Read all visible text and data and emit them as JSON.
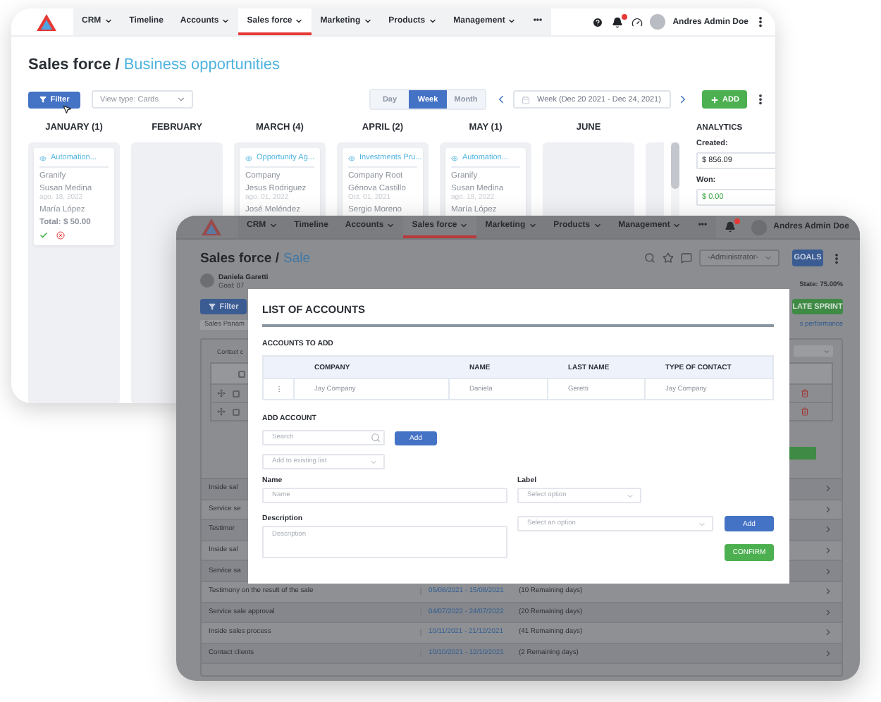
{
  "back_window": {
    "nav": {
      "items": [
        {
          "label": "CRM",
          "dropdown": true,
          "selected": false
        },
        {
          "label": "Timeline",
          "dropdown": false,
          "selected": false
        },
        {
          "label": "Accounts",
          "dropdown": true,
          "selected": false
        },
        {
          "label": "Sales force",
          "dropdown": true,
          "selected": true
        },
        {
          "label": "Marketing",
          "dropdown": true,
          "selected": false
        },
        {
          "label": "Products",
          "dropdown": true,
          "selected": false
        },
        {
          "label": "Management",
          "dropdown": true,
          "selected": false
        },
        {
          "label": "•••",
          "dropdown": false,
          "selected": false
        }
      ],
      "user": "Andres Admin Doe"
    },
    "title": {
      "section": "Sales force /",
      "page": "Business opportunities"
    },
    "toolbar": {
      "filter": "Filter",
      "view_type": "View type: Cards",
      "periods": [
        {
          "label": "Day",
          "selected": false
        },
        {
          "label": "Week",
          "selected": true
        },
        {
          "label": "Month",
          "selected": false
        }
      ],
      "week_range": "Week (Dec 20 2021 - Dec 24, 2021)",
      "add": "ADD"
    },
    "columns": [
      {
        "title": "JANUARY (1)",
        "cards": [
          {
            "link": "Automation...",
            "company": "Granify",
            "contact": "Susan Medina",
            "date": "ago. 18, 2022",
            "owner": "María López",
            "total": "Total: $ 50.00",
            "actions": true
          }
        ]
      },
      {
        "title": "FEBRUARY"
      },
      {
        "title": "MARCH (4)",
        "cards": [
          {
            "link": "Opportunity Ag...",
            "company": "Company",
            "contact": "Jesus Rodriguez",
            "date": "ago. 01, 2022",
            "owner": "José Meléndez"
          }
        ]
      },
      {
        "title": "APRIL (2)",
        "cards": [
          {
            "link": "Investments Pru...",
            "company": "Company Root",
            "contact": "Génova Castillo",
            "date": "Oct. 01, 2021",
            "owner": "Sergio Moreno"
          }
        ]
      },
      {
        "title": "MAY (1)",
        "cards": [
          {
            "link": "Automation...",
            "company": "Granify",
            "contact": "Susan Medina",
            "date": "ago. 18, 2022",
            "owner": "María López"
          }
        ]
      },
      {
        "title": "JUNE"
      }
    ],
    "analytics": {
      "title": "ANALYTICS",
      "created_label": "Created:",
      "created_value": "$ 856.09",
      "won_label": "Won:",
      "won_value": "$ 0.00"
    }
  },
  "front_window": {
    "nav": {
      "items": [
        {
          "label": "CRM",
          "dropdown": true,
          "selected": false
        },
        {
          "label": "Timeline",
          "dropdown": false,
          "selected": false
        },
        {
          "label": "Accounts",
          "dropdown": true,
          "selected": false
        },
        {
          "label": "Sales force",
          "dropdown": true,
          "selected": true
        },
        {
          "label": "Marketing",
          "dropdown": true,
          "selected": false
        },
        {
          "label": "Products",
          "dropdown": true,
          "selected": false
        },
        {
          "label": "Management",
          "dropdown": true,
          "selected": false
        },
        {
          "label": "•••",
          "dropdown": false,
          "selected": false
        }
      ],
      "user": "Andres Admin Doe"
    },
    "title": {
      "section": "Sales force /",
      "page": "Sale"
    },
    "role_select": "-Administrator-",
    "goals": "GOALS",
    "owner": {
      "name": "Daniela Garetti",
      "goal": "Goal: 07"
    },
    "state": "State: 75.00%",
    "subtable": {
      "header_checked": false,
      "rows": [
        {
          "checked": false
        },
        {
          "checked": false
        }
      ]
    },
    "filter": "Filter",
    "sprint_button": "LATE SPRINT",
    "chip": "Sales Panam",
    "performance_link": "s performance",
    "contact_header": "Contact c",
    "rows": [
      {
        "task": "Inside sal"
      },
      {
        "task": "Service se"
      },
      {
        "task": "Testimor"
      },
      {
        "task": "Inside sal"
      },
      {
        "task": "Service sa"
      },
      {
        "task": "Testimony on the result of the sale",
        "dates": "05/08/2021 - 15/08/2021",
        "remaining": "(10 Remaining days)"
      },
      {
        "task": "Service sale approval",
        "dates": "04/07/2022 - 24/07/2022",
        "remaining": "(20 Remaining days)"
      },
      {
        "task": "Inside sales process",
        "dates": "10/11/2021 - 21/12/2021",
        "remaining": "(41 Remaining days)"
      },
      {
        "task": "Contact clients",
        "dates": "10/10/2021 - 12/10/2021",
        "remaining": "(2 Remaining days)"
      }
    ],
    "modal": {
      "title": "LIST OF ACCOUNTS",
      "accounts_heading": "ACCOUNTS TO ADD",
      "columns": [
        "COMPANY",
        "NAME",
        "LAST NAME",
        "TYPE OF CONTACT"
      ],
      "rows": [
        [
          "Jay Company",
          "Daniela",
          "Geretti",
          "Jay Company"
        ]
      ],
      "add_heading": "ADD ACCOUNT",
      "search": {
        "placeholder": "Search"
      },
      "search_add": "Add",
      "existing_list": "Add to existing list",
      "name_label": "Name",
      "name": {
        "placeholder": "Name"
      },
      "label_label": "Label",
      "label_select": "Select option",
      "description_label": "Description",
      "description": {
        "placeholder": "Description"
      },
      "option_select": "Select an option",
      "option_add": "Add",
      "confirm": "CONFIRM"
    }
  }
}
